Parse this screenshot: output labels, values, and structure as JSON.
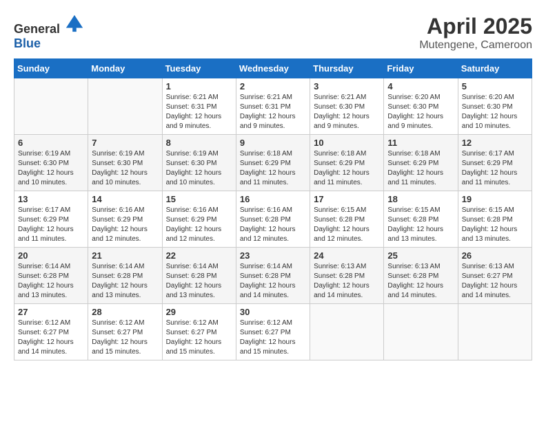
{
  "logo": {
    "text_general": "General",
    "text_blue": "Blue"
  },
  "title": "April 2025",
  "location": "Mutengene, Cameroon",
  "weekdays": [
    "Sunday",
    "Monday",
    "Tuesday",
    "Wednesday",
    "Thursday",
    "Friday",
    "Saturday"
  ],
  "weeks": [
    [
      {
        "day": "",
        "sunrise": "",
        "sunset": "",
        "daylight": ""
      },
      {
        "day": "",
        "sunrise": "",
        "sunset": "",
        "daylight": ""
      },
      {
        "day": "1",
        "sunrise": "Sunrise: 6:21 AM",
        "sunset": "Sunset: 6:31 PM",
        "daylight": "Daylight: 12 hours and 9 minutes."
      },
      {
        "day": "2",
        "sunrise": "Sunrise: 6:21 AM",
        "sunset": "Sunset: 6:31 PM",
        "daylight": "Daylight: 12 hours and 9 minutes."
      },
      {
        "day": "3",
        "sunrise": "Sunrise: 6:21 AM",
        "sunset": "Sunset: 6:30 PM",
        "daylight": "Daylight: 12 hours and 9 minutes."
      },
      {
        "day": "4",
        "sunrise": "Sunrise: 6:20 AM",
        "sunset": "Sunset: 6:30 PM",
        "daylight": "Daylight: 12 hours and 9 minutes."
      },
      {
        "day": "5",
        "sunrise": "Sunrise: 6:20 AM",
        "sunset": "Sunset: 6:30 PM",
        "daylight": "Daylight: 12 hours and 10 minutes."
      }
    ],
    [
      {
        "day": "6",
        "sunrise": "Sunrise: 6:19 AM",
        "sunset": "Sunset: 6:30 PM",
        "daylight": "Daylight: 12 hours and 10 minutes."
      },
      {
        "day": "7",
        "sunrise": "Sunrise: 6:19 AM",
        "sunset": "Sunset: 6:30 PM",
        "daylight": "Daylight: 12 hours and 10 minutes."
      },
      {
        "day": "8",
        "sunrise": "Sunrise: 6:19 AM",
        "sunset": "Sunset: 6:30 PM",
        "daylight": "Daylight: 12 hours and 10 minutes."
      },
      {
        "day": "9",
        "sunrise": "Sunrise: 6:18 AM",
        "sunset": "Sunset: 6:29 PM",
        "daylight": "Daylight: 12 hours and 11 minutes."
      },
      {
        "day": "10",
        "sunrise": "Sunrise: 6:18 AM",
        "sunset": "Sunset: 6:29 PM",
        "daylight": "Daylight: 12 hours and 11 minutes."
      },
      {
        "day": "11",
        "sunrise": "Sunrise: 6:18 AM",
        "sunset": "Sunset: 6:29 PM",
        "daylight": "Daylight: 12 hours and 11 minutes."
      },
      {
        "day": "12",
        "sunrise": "Sunrise: 6:17 AM",
        "sunset": "Sunset: 6:29 PM",
        "daylight": "Daylight: 12 hours and 11 minutes."
      }
    ],
    [
      {
        "day": "13",
        "sunrise": "Sunrise: 6:17 AM",
        "sunset": "Sunset: 6:29 PM",
        "daylight": "Daylight: 12 hours and 11 minutes."
      },
      {
        "day": "14",
        "sunrise": "Sunrise: 6:16 AM",
        "sunset": "Sunset: 6:29 PM",
        "daylight": "Daylight: 12 hours and 12 minutes."
      },
      {
        "day": "15",
        "sunrise": "Sunrise: 6:16 AM",
        "sunset": "Sunset: 6:29 PM",
        "daylight": "Daylight: 12 hours and 12 minutes."
      },
      {
        "day": "16",
        "sunrise": "Sunrise: 6:16 AM",
        "sunset": "Sunset: 6:28 PM",
        "daylight": "Daylight: 12 hours and 12 minutes."
      },
      {
        "day": "17",
        "sunrise": "Sunrise: 6:15 AM",
        "sunset": "Sunset: 6:28 PM",
        "daylight": "Daylight: 12 hours and 12 minutes."
      },
      {
        "day": "18",
        "sunrise": "Sunrise: 6:15 AM",
        "sunset": "Sunset: 6:28 PM",
        "daylight": "Daylight: 12 hours and 13 minutes."
      },
      {
        "day": "19",
        "sunrise": "Sunrise: 6:15 AM",
        "sunset": "Sunset: 6:28 PM",
        "daylight": "Daylight: 12 hours and 13 minutes."
      }
    ],
    [
      {
        "day": "20",
        "sunrise": "Sunrise: 6:14 AM",
        "sunset": "Sunset: 6:28 PM",
        "daylight": "Daylight: 12 hours and 13 minutes."
      },
      {
        "day": "21",
        "sunrise": "Sunrise: 6:14 AM",
        "sunset": "Sunset: 6:28 PM",
        "daylight": "Daylight: 12 hours and 13 minutes."
      },
      {
        "day": "22",
        "sunrise": "Sunrise: 6:14 AM",
        "sunset": "Sunset: 6:28 PM",
        "daylight": "Daylight: 12 hours and 13 minutes."
      },
      {
        "day": "23",
        "sunrise": "Sunrise: 6:14 AM",
        "sunset": "Sunset: 6:28 PM",
        "daylight": "Daylight: 12 hours and 14 minutes."
      },
      {
        "day": "24",
        "sunrise": "Sunrise: 6:13 AM",
        "sunset": "Sunset: 6:28 PM",
        "daylight": "Daylight: 12 hours and 14 minutes."
      },
      {
        "day": "25",
        "sunrise": "Sunrise: 6:13 AM",
        "sunset": "Sunset: 6:28 PM",
        "daylight": "Daylight: 12 hours and 14 minutes."
      },
      {
        "day": "26",
        "sunrise": "Sunrise: 6:13 AM",
        "sunset": "Sunset: 6:27 PM",
        "daylight": "Daylight: 12 hours and 14 minutes."
      }
    ],
    [
      {
        "day": "27",
        "sunrise": "Sunrise: 6:12 AM",
        "sunset": "Sunset: 6:27 PM",
        "daylight": "Daylight: 12 hours and 14 minutes."
      },
      {
        "day": "28",
        "sunrise": "Sunrise: 6:12 AM",
        "sunset": "Sunset: 6:27 PM",
        "daylight": "Daylight: 12 hours and 15 minutes."
      },
      {
        "day": "29",
        "sunrise": "Sunrise: 6:12 AM",
        "sunset": "Sunset: 6:27 PM",
        "daylight": "Daylight: 12 hours and 15 minutes."
      },
      {
        "day": "30",
        "sunrise": "Sunrise: 6:12 AM",
        "sunset": "Sunset: 6:27 PM",
        "daylight": "Daylight: 12 hours and 15 minutes."
      },
      {
        "day": "",
        "sunrise": "",
        "sunset": "",
        "daylight": ""
      },
      {
        "day": "",
        "sunrise": "",
        "sunset": "",
        "daylight": ""
      },
      {
        "day": "",
        "sunrise": "",
        "sunset": "",
        "daylight": ""
      }
    ]
  ]
}
